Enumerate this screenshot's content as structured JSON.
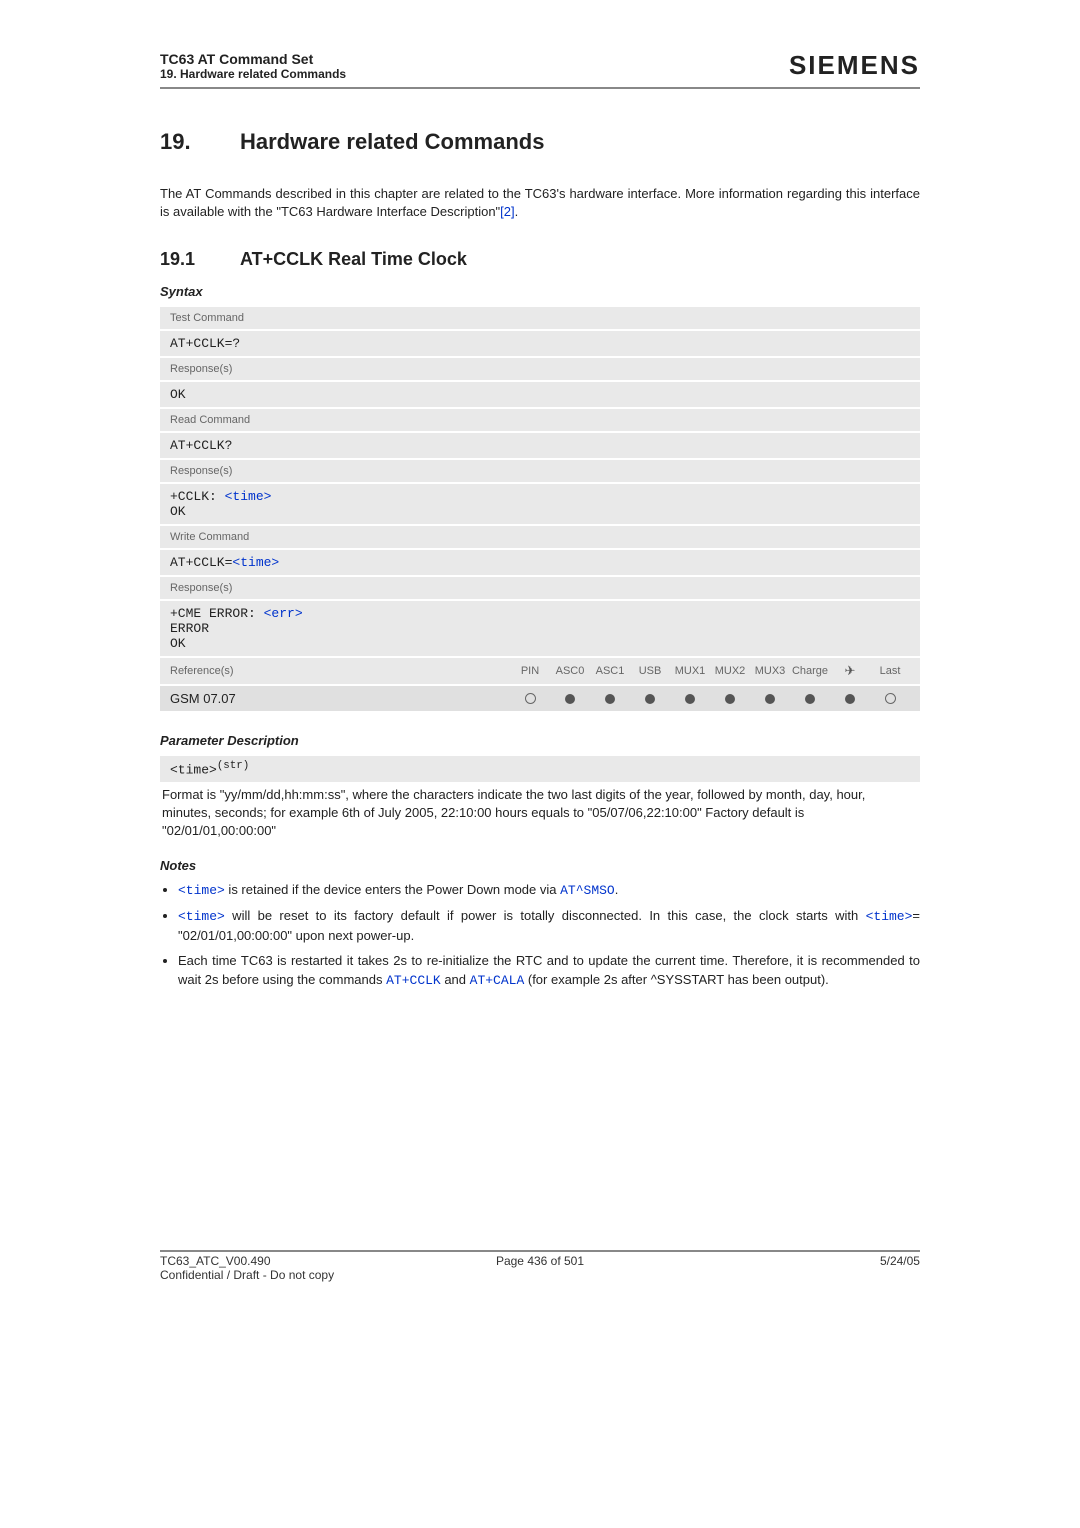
{
  "header": {
    "title": "TC63 AT Command Set",
    "sub": "19. Hardware related Commands",
    "logo": "SIEMENS"
  },
  "section": {
    "num": "19.",
    "title": "Hardware related Commands"
  },
  "intro": "The AT Commands described in this chapter are related to the TC63's hardware interface. More information regarding this interface is available with the \"TC63 Hardware Interface Description\"",
  "intro_link": "[2]",
  "sub": {
    "num": "19.1",
    "title": "AT+CCLK   Real Time Clock"
  },
  "syntax_label": "Syntax",
  "box": {
    "test_label": "Test Command",
    "test_cmd": "AT+CCLK=?",
    "resp_label": "Response(s)",
    "ok": "OK",
    "read_label": "Read Command",
    "read_cmd": "AT+CCLK?",
    "read_resp_prefix": "+CCLK: ",
    "time_link": "<time>",
    "write_label": "Write Command",
    "write_cmd_prefix": "AT+CCLK=",
    "cme_prefix": "+CME ERROR: ",
    "err_link": "<err>",
    "error": "ERROR",
    "refs_label": "Reference(s)",
    "cols": [
      "PIN",
      "ASC0",
      "ASC1",
      "USB",
      "MUX1",
      "MUX2",
      "MUX3",
      "Charge",
      "✈",
      "Last"
    ],
    "ref_value": "GSM 07.07"
  },
  "param": {
    "heading": "Parameter Description",
    "name": "<time>",
    "sup": "(str)",
    "desc": "Format is \"yy/mm/dd,hh:mm:ss\", where the characters indicate the two last digits of the year, followed by month, day, hour, minutes, seconds; for example 6th of July 2005, 22:10:00 hours equals to \"05/07/06,22:10:00\" Factory default is \"02/01/01,00:00:00\""
  },
  "notes": {
    "heading": "Notes",
    "n1a": " is retained if the device enters the Power Down mode via ",
    "n1b": ".",
    "n2a": " will be reset to its factory default if power is totally disconnected. In this case, the clock starts with ",
    "n2b": "= \"02/01/01,00:00:00\" upon next power-up.",
    "n3a": "Each time TC63 is restarted it takes 2s to re-initialize the RTC and to update the current time. Therefore, it is recommended to wait 2s before using the commands ",
    "n3b": " and ",
    "n3c": " (for example 2s after ^SYSSTART has been output).",
    "at_cclk": "AT+CCLK",
    "at_cala": "AT+CALA",
    "at_smso": "AT^SMSO",
    "time": "<time>"
  },
  "footer": {
    "left1": "TC63_ATC_V00.490",
    "left2": "Confidential / Draft - Do not copy",
    "center": "Page 436 of 501",
    "right": "5/24/05"
  }
}
